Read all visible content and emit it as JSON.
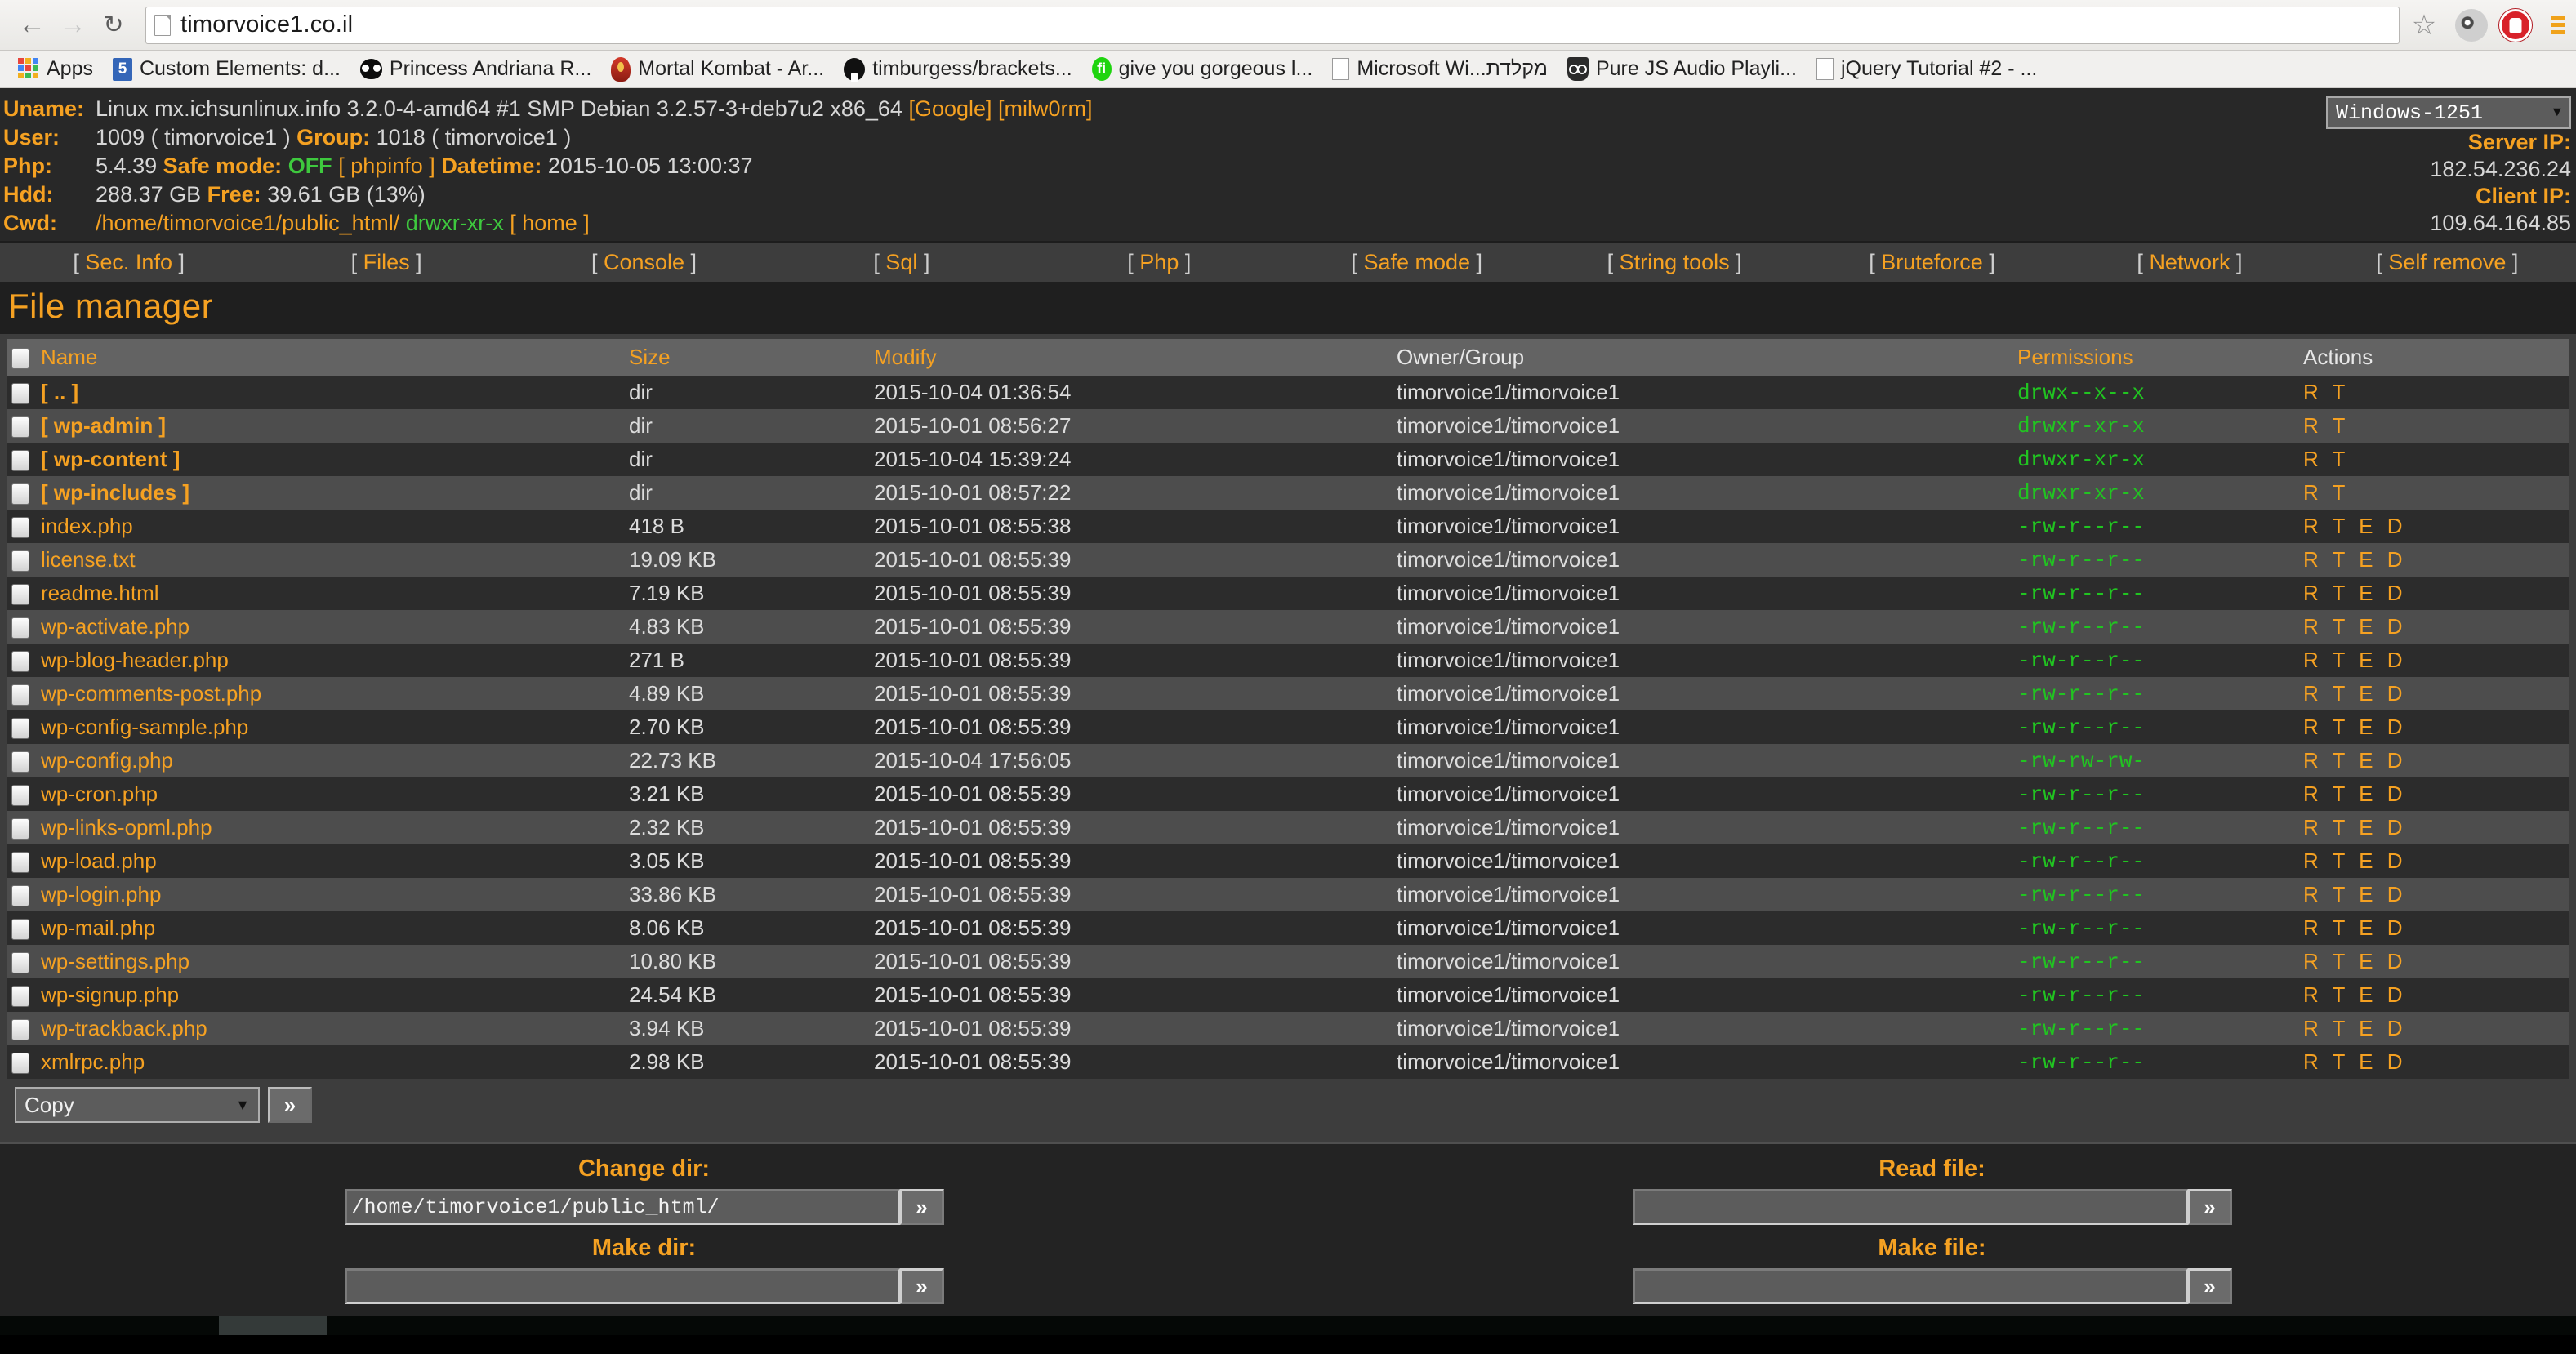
{
  "browser": {
    "back_icon": "back-arrow-icon",
    "forward_icon": "forward-arrow-icon",
    "reload_icon": "reload-icon",
    "url": "timorvoice1.co.il",
    "star_icon": "★",
    "bookmarks": [
      {
        "label": "Apps",
        "icon": "apps-grid-icon"
      },
      {
        "label": "Custom Elements: d...",
        "icon": "html5-icon"
      },
      {
        "label": "Princess Andriana R...",
        "icon": "owl-icon"
      },
      {
        "label": "Mortal Kombat - Ar...",
        "icon": "kombat-icon"
      },
      {
        "label": "timburgess/brackets...",
        "icon": "github-icon"
      },
      {
        "label": "give you gorgeous l...",
        "icon": "green-pill-icon"
      },
      {
        "label": "Microsoft Wi...מקלדת",
        "icon": "page-icon"
      },
      {
        "label": "Pure JS Audio Playli...",
        "icon": "purejs-icon"
      },
      {
        "label": "jQuery Tutorial #2 - ...",
        "icon": "page-icon"
      }
    ]
  },
  "sysinfo": {
    "uname_label": "Uname:",
    "uname_value": "Linux mx.ichsunlinux.info 3.2.0-4-amd64 #1 SMP Debian 3.2.57-3+deb7u2 x86_64",
    "uname_link_google": "[Google]",
    "uname_link_milw0rm": "[milw0rm]",
    "user_label": "User:",
    "user_value": "1009 ( timorvoice1 )",
    "group_label": "Group:",
    "group_value": "1018 ( timorvoice1 )",
    "php_label": "Php:",
    "php_value": "5.4.39",
    "safemode_label": "Safe mode:",
    "safemode_value": "OFF",
    "phpinfo_link": "[ phpinfo ]",
    "datetime_label": "Datetime:",
    "datetime_value": "2015-10-05 13:00:37",
    "hdd_label": "Hdd:",
    "hdd_value": "288.37 GB",
    "free_label": "Free:",
    "free_value": "39.61 GB (13%)",
    "cwd_label": "Cwd:",
    "cwd_value": "/home/timorvoice1/public_html/",
    "cwd_perm": "drwxr-xr-x",
    "home_link": "[ home ]",
    "encoding_selected": "Windows-1251",
    "server_ip_label": "Server IP:",
    "server_ip": "182.54.236.24",
    "client_ip_label": "Client IP:",
    "client_ip": "109.64.164.85"
  },
  "menu": [
    "Sec. Info",
    "Files",
    "Console",
    "Sql",
    "Php",
    "Safe mode",
    "String tools",
    "Bruteforce",
    "Network",
    "Self remove"
  ],
  "filemanager": {
    "title": "File manager",
    "columns": [
      "Name",
      "Size",
      "Modify",
      "Owner/Group",
      "Permissions",
      "Actions"
    ],
    "rows": [
      {
        "name": "[ .. ]",
        "dir": true,
        "size": "dir",
        "modify": "2015-10-04 01:36:54",
        "owner": "timorvoice1/timorvoice1",
        "perm": "drwx--x--x",
        "actions": "R T"
      },
      {
        "name": "[ wp-admin ]",
        "dir": true,
        "size": "dir",
        "modify": "2015-10-01 08:56:27",
        "owner": "timorvoice1/timorvoice1",
        "perm": "drwxr-xr-x",
        "actions": "R T"
      },
      {
        "name": "[ wp-content ]",
        "dir": true,
        "size": "dir",
        "modify": "2015-10-04 15:39:24",
        "owner": "timorvoice1/timorvoice1",
        "perm": "drwxr-xr-x",
        "actions": "R T"
      },
      {
        "name": "[ wp-includes ]",
        "dir": true,
        "size": "dir",
        "modify": "2015-10-01 08:57:22",
        "owner": "timorvoice1/timorvoice1",
        "perm": "drwxr-xr-x",
        "actions": "R T"
      },
      {
        "name": "index.php",
        "dir": false,
        "size": "418 B",
        "modify": "2015-10-01 08:55:38",
        "owner": "timorvoice1/timorvoice1",
        "perm": "-rw-r--r--",
        "actions": "R T E D"
      },
      {
        "name": "license.txt",
        "dir": false,
        "size": "19.09 KB",
        "modify": "2015-10-01 08:55:39",
        "owner": "timorvoice1/timorvoice1",
        "perm": "-rw-r--r--",
        "actions": "R T E D"
      },
      {
        "name": "readme.html",
        "dir": false,
        "size": "7.19 KB",
        "modify": "2015-10-01 08:55:39",
        "owner": "timorvoice1/timorvoice1",
        "perm": "-rw-r--r--",
        "actions": "R T E D"
      },
      {
        "name": "wp-activate.php",
        "dir": false,
        "size": "4.83 KB",
        "modify": "2015-10-01 08:55:39",
        "owner": "timorvoice1/timorvoice1",
        "perm": "-rw-r--r--",
        "actions": "R T E D"
      },
      {
        "name": "wp-blog-header.php",
        "dir": false,
        "size": "271 B",
        "modify": "2015-10-01 08:55:39",
        "owner": "timorvoice1/timorvoice1",
        "perm": "-rw-r--r--",
        "actions": "R T E D"
      },
      {
        "name": "wp-comments-post.php",
        "dir": false,
        "size": "4.89 KB",
        "modify": "2015-10-01 08:55:39",
        "owner": "timorvoice1/timorvoice1",
        "perm": "-rw-r--r--",
        "actions": "R T E D"
      },
      {
        "name": "wp-config-sample.php",
        "dir": false,
        "size": "2.70 KB",
        "modify": "2015-10-01 08:55:39",
        "owner": "timorvoice1/timorvoice1",
        "perm": "-rw-r--r--",
        "actions": "R T E D"
      },
      {
        "name": "wp-config.php",
        "dir": false,
        "size": "22.73 KB",
        "modify": "2015-10-04 17:56:05",
        "owner": "timorvoice1/timorvoice1",
        "perm": "-rw-rw-rw-",
        "actions": "R T E D"
      },
      {
        "name": "wp-cron.php",
        "dir": false,
        "size": "3.21 KB",
        "modify": "2015-10-01 08:55:39",
        "owner": "timorvoice1/timorvoice1",
        "perm": "-rw-r--r--",
        "actions": "R T E D"
      },
      {
        "name": "wp-links-opml.php",
        "dir": false,
        "size": "2.32 KB",
        "modify": "2015-10-01 08:55:39",
        "owner": "timorvoice1/timorvoice1",
        "perm": "-rw-r--r--",
        "actions": "R T E D"
      },
      {
        "name": "wp-load.php",
        "dir": false,
        "size": "3.05 KB",
        "modify": "2015-10-01 08:55:39",
        "owner": "timorvoice1/timorvoice1",
        "perm": "-rw-r--r--",
        "actions": "R T E D"
      },
      {
        "name": "wp-login.php",
        "dir": false,
        "size": "33.86 KB",
        "modify": "2015-10-01 08:55:39",
        "owner": "timorvoice1/timorvoice1",
        "perm": "-rw-r--r--",
        "actions": "R T E D"
      },
      {
        "name": "wp-mail.php",
        "dir": false,
        "size": "8.06 KB",
        "modify": "2015-10-01 08:55:39",
        "owner": "timorvoice1/timorvoice1",
        "perm": "-rw-r--r--",
        "actions": "R T E D"
      },
      {
        "name": "wp-settings.php",
        "dir": false,
        "size": "10.80 KB",
        "modify": "2015-10-01 08:55:39",
        "owner": "timorvoice1/timorvoice1",
        "perm": "-rw-r--r--",
        "actions": "R T E D"
      },
      {
        "name": "wp-signup.php",
        "dir": false,
        "size": "24.54 KB",
        "modify": "2015-10-01 08:55:39",
        "owner": "timorvoice1/timorvoice1",
        "perm": "-rw-r--r--",
        "actions": "R T E D"
      },
      {
        "name": "wp-trackback.php",
        "dir": false,
        "size": "3.94 KB",
        "modify": "2015-10-01 08:55:39",
        "owner": "timorvoice1/timorvoice1",
        "perm": "-rw-r--r--",
        "actions": "R T E D"
      },
      {
        "name": "xmlrpc.php",
        "dir": false,
        "size": "2.98 KB",
        "modify": "2015-10-01 08:55:39",
        "owner": "timorvoice1/timorvoice1",
        "perm": "-rw-r--r--",
        "actions": "R T E D"
      }
    ],
    "bulk_action_selected": "Copy",
    "bulk_go": "»"
  },
  "forms": {
    "change_dir_label": "Change dir:",
    "change_dir_value": "/home/timorvoice1/public_html/",
    "make_dir_label": "Make dir:",
    "make_dir_value": "",
    "read_file_label": "Read file:",
    "read_file_value": "",
    "make_file_label": "Make file:",
    "make_file_value": "",
    "go": "»"
  },
  "colors": {
    "accent_orange": "#f5a122",
    "perm_green": "#21c421",
    "bg_dark": "#282828",
    "row_odd": "#2c2c2c",
    "row_even": "#4d4d4d",
    "header_row": "#636363"
  }
}
